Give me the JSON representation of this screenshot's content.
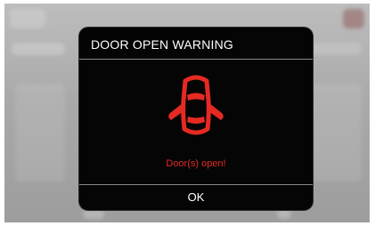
{
  "dialog": {
    "title": "DOOR OPEN WARNING",
    "message": "Door(s) open!",
    "ok_label": "OK",
    "icon": "car-doors-open-icon"
  },
  "colors": {
    "warning_red": "#e62a22",
    "dialog_bg": "#050505",
    "text_white": "#ffffff"
  }
}
